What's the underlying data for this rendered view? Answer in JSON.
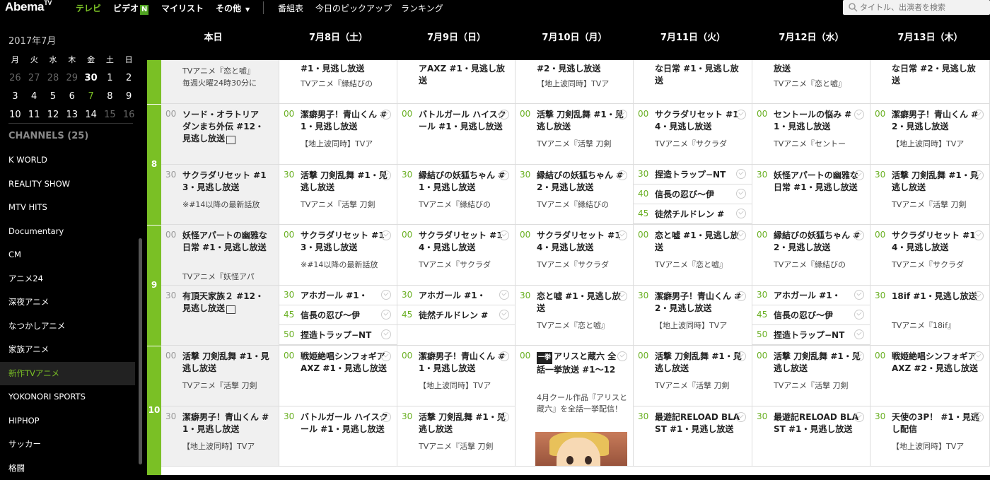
{
  "topbar": {
    "logo": "Abema",
    "logo_sup": "TV",
    "nav": [
      "テレビ",
      "ビデオ",
      "マイリスト",
      "その他"
    ],
    "video_badge": "N",
    "links": [
      "番組表",
      "今日のピックアップ",
      "ランキング"
    ],
    "search_placeholder": "タイトル、出演者を検索"
  },
  "sidebar": {
    "month": "2017年7月",
    "weekdays": [
      "月",
      "火",
      "水",
      "木",
      "金",
      "土",
      "日"
    ],
    "weeks": [
      [
        "26",
        "27",
        "28",
        "29",
        "30",
        "1",
        "2"
      ],
      [
        "3",
        "4",
        "5",
        "6",
        "7",
        "8",
        "9"
      ],
      [
        "10",
        "11",
        "12",
        "13",
        "14",
        "15",
        "16"
      ]
    ],
    "channels_header": "CHANNELS (25)",
    "channels": [
      "K WORLD",
      "REALITY SHOW",
      "MTV HITS",
      "Documentary",
      "CM",
      "アニメ24",
      "深夜アニメ",
      "なつかしアニメ",
      "家族アニメ",
      "新作TVアニメ",
      "YOKONORI SPORTS",
      "HIPHOP",
      "サッカー",
      "格闘"
    ],
    "active_channel": "新作TVアニメ"
  },
  "grid": {
    "days": [
      "本日",
      "7月8日（土）",
      "7月9日（日）",
      "7月10日（月）",
      "7月11日（火）",
      "7月12日（水）",
      "7月13日（木）"
    ],
    "hours": [
      "8",
      "9",
      "10"
    ],
    "rows": [
      [
        {
          "t": "",
          "d": "TVアニメ『恋と嘘』",
          "d2": "毎週火曜24時30分に"
        },
        {
          "t": "#1・見逃し放送",
          "d": "TVアニメ『縁結びの"
        },
        {
          "t": "アAXZ #1・見逃し放送",
          "d": ""
        },
        {
          "t": "#2・見逃し放送",
          "d": "【地上波同時】TVア"
        },
        {
          "t": "な日常 #1・見逃し放送",
          "d": ""
        },
        {
          "t": "放送",
          "d": "TVアニメ『恋と嘘』"
        },
        {
          "t": "な日常 #2・見逃し放送",
          "d": ""
        }
      ],
      [
        {
          "m": "00",
          "t": "ソード・オラトリア ダンまち外伝 #12・見逃し放送",
          "d": ""
        },
        {
          "m": "00",
          "t": "潔癖男子！青山くん #1・見逃し放送",
          "d": "【地上波同時】TVア"
        },
        {
          "m": "00",
          "t": "バトルガール ハイスクール #1・見逃し放送",
          "d": ""
        },
        {
          "m": "00",
          "t": "活撃 刀剣乱舞 #1・見逃し放送",
          "d": "TVアニメ『活撃 刀剣"
        },
        {
          "m": "00",
          "t": "サクラダリセット #14・見逃し放送",
          "d": "TVアニメ『サクラダ"
        },
        {
          "m": "00",
          "t": "セントールの悩み #1・見逃し放送",
          "d": "TVアニメ『セントー"
        },
        {
          "m": "00",
          "t": "潔癖男子！青山くん #2・見逃し放送",
          "d": "【地上波同時】TVア"
        }
      ],
      [
        {
          "m": "30",
          "t": "サクラダリセット #13・見逃し放送",
          "d": "※#14以降の最新話放"
        },
        {
          "m": "30",
          "t": "活撃 刀剣乱舞 #1・見逃し放送",
          "d": "TVアニメ『活撃 刀剣"
        },
        {
          "m": "30",
          "t": "縁結びの妖狐ちゃん #1・見逃し放送",
          "d": "TVアニメ『縁結びの"
        },
        {
          "m": "30",
          "t": "縁結びの妖狐ちゃん #2・見逃し放送",
          "d": "TVアニメ『縁結びの"
        },
        {
          "multi": [
            {
              "m": "30",
              "t": "捏造トラップ−NT"
            },
            {
              "m": "40",
              "t": "信長の忍び〜伊"
            },
            {
              "m": "45",
              "t": "徒然チルドレン #"
            }
          ]
        },
        {
          "m": "30",
          "t": "妖怪アパートの幽雅な日常 #1・見逃し放送",
          "d": ""
        },
        {
          "m": "30",
          "t": "活撃 刀剣乱舞 #1・見逃し放送",
          "d": "TVアニメ『活撃 刀剣"
        }
      ],
      [
        {
          "m": "00",
          "t": "妖怪アパートの幽雅な日常 #1・見逃し放送",
          "d": "TVアニメ『妖怪アパ"
        },
        {
          "m": "00",
          "t": "サクラダリセット #13・見逃し放送",
          "d": "※#14以降の最新話放"
        },
        {
          "m": "00",
          "t": "サクラダリセット #14・見逃し放送",
          "d": "TVアニメ『サクラダ"
        },
        {
          "m": "00",
          "t": "サクラダリセット #14・見逃し放送",
          "d": "TVアニメ『サクラダ"
        },
        {
          "m": "00",
          "t": "恋と嘘 #1・見逃し放送",
          "d": "TVアニメ『恋と嘘』"
        },
        {
          "m": "00",
          "t": "縁結びの妖狐ちゃん #2・見逃し放送",
          "d": "TVアニメ『縁結びの"
        },
        {
          "m": "00",
          "t": "サクラダリセット #14・見逃し放送",
          "d": "TVアニメ『サクラダ"
        }
      ],
      [
        {
          "m": "30",
          "t": "有頂天家族２ #12・見逃し放送",
          "d": ""
        },
        {
          "multi": [
            {
              "m": "30",
              "t": "アホガール #1・"
            },
            {
              "m": "45",
              "t": "信長の忍び〜伊"
            },
            {
              "m": "50",
              "t": "捏造トラップ−NT"
            }
          ]
        },
        {
          "multi": [
            {
              "m": "30",
              "t": "アホガール #1・"
            },
            {
              "m": "45",
              "t": "徒然チルドレン #"
            }
          ]
        },
        {
          "m": "30",
          "t": "恋と嘘 #1・見逃し放送",
          "d": "TVアニメ『恋と嘘』"
        },
        {
          "m": "30",
          "t": "潔癖男子！青山くん #2・見逃し放送",
          "d": "【地上波同時】TVア"
        },
        {
          "multi": [
            {
              "m": "30",
              "t": "アホガール #1・"
            },
            {
              "m": "45",
              "t": "信長の忍び〜伊"
            },
            {
              "m": "50",
              "t": "捏造トラップ−NT"
            }
          ]
        },
        {
          "m": "30",
          "t": "18if #1・見逃し放送",
          "d": "TVアニメ『18if』"
        }
      ],
      [
        {
          "m": "00",
          "t": "活撃 刀剣乱舞 #1・見逃し放送",
          "d": "TVアニメ『活撃 刀剣"
        },
        {
          "m": "00",
          "t": "戦姫絶唱シンフォギアAXZ #1・見逃し放送",
          "d": ""
        },
        {
          "m": "00",
          "t": "潔癖男子！青山くん #1・見逃し放送",
          "d": "【地上波同時】TVア"
        },
        {
          "m": "00",
          "t": "アリスと蔵六 全話一挙放送 #1〜12",
          "d": "4月クール作品『アリスと蔵六』を全話一挙配信！",
          "badge": "一挙",
          "tall": true
        },
        {
          "m": "00",
          "t": "活撃 刀剣乱舞 #1・見逃し放送",
          "d": "TVアニメ『活撃 刀剣"
        },
        {
          "m": "00",
          "t": "活撃 刀剣乱舞 #1・見逃し放送",
          "d": "TVアニメ『活撃 刀剣"
        },
        {
          "m": "00",
          "t": "戦姫絶唱シンフォギアAXZ #2・見逃し放送",
          "d": ""
        }
      ],
      [
        {
          "m": "30",
          "t": "潔癖男子！青山くん #1・見逃し放送",
          "d": "【地上波同時】TVア"
        },
        {
          "m": "30",
          "t": "バトルガール ハイスクール #1・見逃し放送",
          "d": ""
        },
        {
          "m": "30",
          "t": "活撃 刀剣乱舞 #1・見逃し放送",
          "d": "TVアニメ『活撃 刀剣"
        },
        null,
        {
          "m": "30",
          "t": "最遊記RELOAD BLAST #1・見逃し放送",
          "d": ""
        },
        {
          "m": "30",
          "t": "最遊記RELOAD BLAST #1・見逃し放送",
          "d": ""
        },
        {
          "m": "30",
          "t": "天使の3P！ #1・見逃し配信",
          "d": "【地上波同時】TVア"
        }
      ]
    ]
  }
}
